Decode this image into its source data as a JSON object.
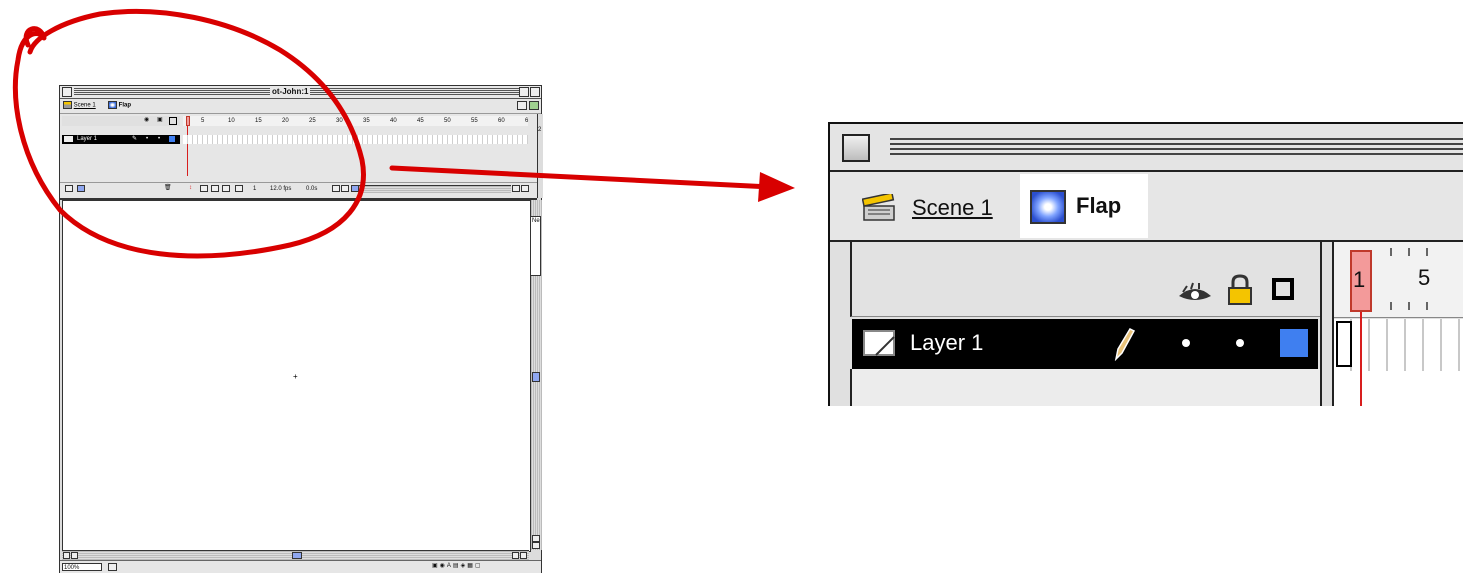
{
  "small_window": {
    "title": "ot-John:1",
    "tabs": {
      "scene": "Scene 1",
      "symbol": "Flap"
    },
    "layer_name": "Layer 1",
    "ruler_numbers": [
      "5",
      "10",
      "15",
      "20",
      "25",
      "30",
      "35",
      "40",
      "45",
      "50",
      "55",
      "60",
      "6"
    ],
    "status": {
      "frame": "1",
      "fps": "12.0 fps",
      "time": "0.0s"
    },
    "zoom": "100%",
    "side_labels": {
      "ruler_2": "2",
      "panel_ne": "Ne"
    },
    "stage_marker": "+"
  },
  "zoom_view": {
    "tabs": {
      "scene": "Scene 1",
      "symbol": "Flap"
    },
    "layer_name": "Layer 1",
    "ruler_numbers": [
      "1",
      "5"
    ]
  },
  "colors": {
    "annotation_red": "#d80000",
    "layer_swatch": "#3f7ff0",
    "playhead_fill": "#f39a9a"
  }
}
